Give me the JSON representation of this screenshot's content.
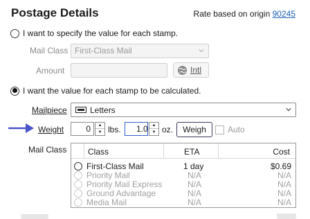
{
  "header": {
    "title": "Postage Details",
    "rate_prefix": "Rate based on origin",
    "origin_zip": "90245"
  },
  "specify_option": {
    "label": "I want to specify the value for each stamp.",
    "selected": false,
    "mail_class_label": "Mail Class",
    "mail_class_value": "First-Class Mail",
    "amount_label": "Amount",
    "amount_value": "",
    "intl_button": "Intl"
  },
  "calculate_option": {
    "label": "I want the value for each stamp to be calculated.",
    "selected": true,
    "mailpiece_label": "Mailpiece",
    "mailpiece_value": "Letters",
    "weight_label": "Weight",
    "lbs_value": "0",
    "lbs_unit": "lbs.",
    "oz_value": "1.0",
    "oz_unit": "oz.",
    "weigh_button": "Weigh",
    "auto_label": "Auto",
    "auto_checked": false,
    "mail_class_label": "Mail Class"
  },
  "mail_class_table": {
    "columns": [
      "Class",
      "ETA",
      "Cost"
    ],
    "rows": [
      {
        "class": "First-Class Mail",
        "eta": "1 day",
        "cost": "$0.69",
        "enabled": true
      },
      {
        "class": "Priority Mail",
        "eta": "N/A",
        "cost": "N/A",
        "enabled": false
      },
      {
        "class": "Priority Mail Express",
        "eta": "N/A",
        "cost": "N/A",
        "enabled": false
      },
      {
        "class": "Ground Advantage",
        "eta": "N/A",
        "cost": "N/A",
        "enabled": false
      },
      {
        "class": "Media Mail",
        "eta": "N/A",
        "cost": "N/A",
        "enabled": false
      }
    ]
  },
  "colors": {
    "link": "#1a5fb4",
    "arrow": "#4a55c8"
  }
}
